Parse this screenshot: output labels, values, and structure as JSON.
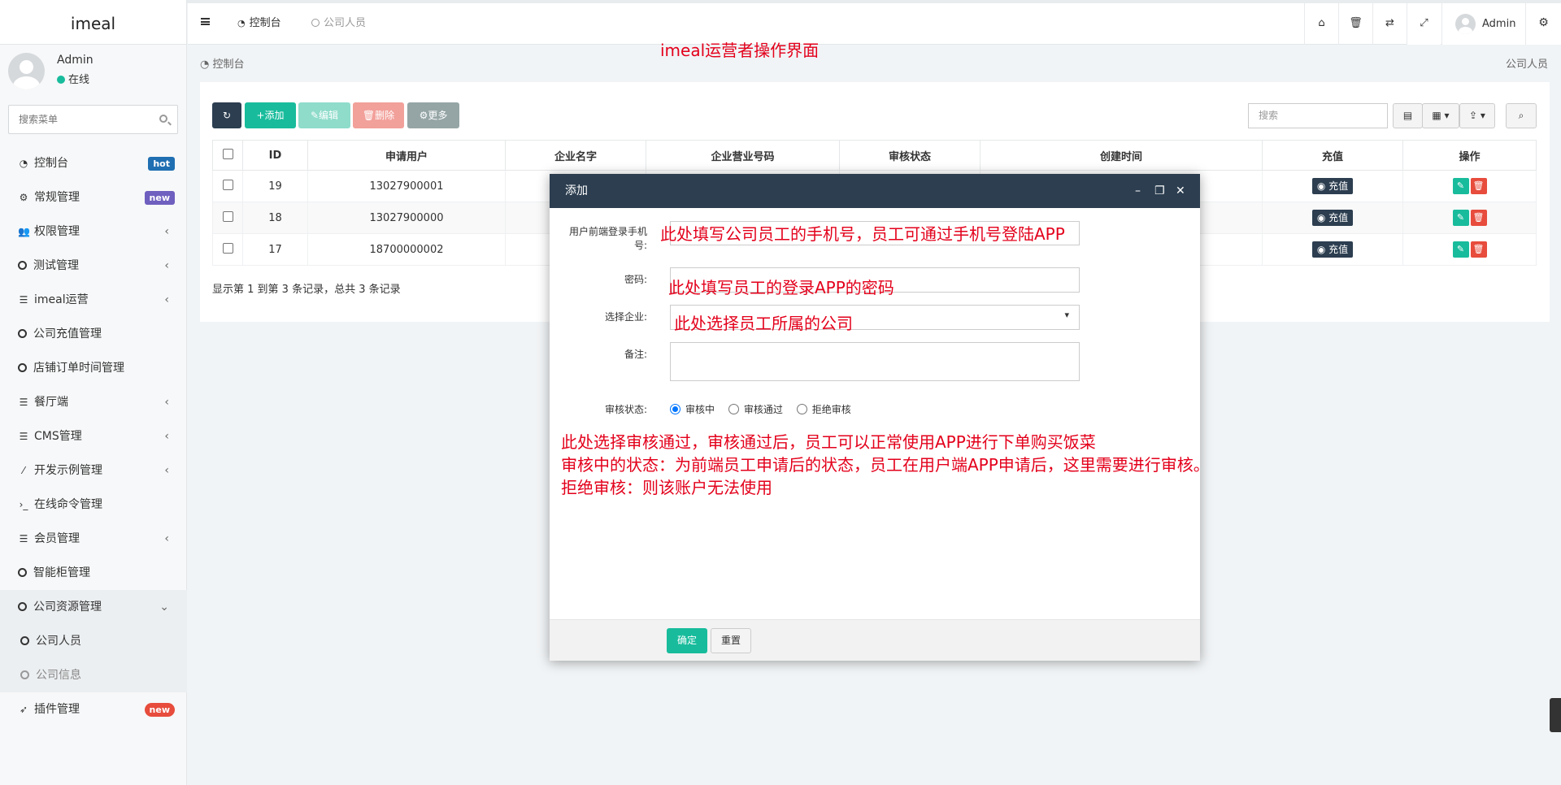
{
  "sidebar": {
    "logo": "imeal",
    "user": {
      "name": "Admin",
      "status": "在线"
    },
    "search_placeholder": "搜索菜单",
    "items": [
      {
        "label": "控制台",
        "icon": "dashboard-icon",
        "badge": "hot"
      },
      {
        "label": "常规管理",
        "icon": "cogs-icon",
        "badge": "new"
      },
      {
        "label": "权限管理",
        "icon": "group-icon"
      },
      {
        "label": "测试管理",
        "icon": "circle-icon"
      },
      {
        "label": "imeal运营",
        "icon": "list-icon"
      },
      {
        "label": "公司充值管理",
        "icon": "circle-icon"
      },
      {
        "label": "店铺订单时间管理",
        "icon": "circle-icon"
      },
      {
        "label": "餐厅端",
        "icon": "list-icon"
      },
      {
        "label": "CMS管理",
        "icon": "list-icon"
      },
      {
        "label": "开发示例管理",
        "icon": "magic-icon"
      },
      {
        "label": "在线命令管理",
        "icon": "terminal-icon"
      },
      {
        "label": "会员管理",
        "icon": "list-icon"
      },
      {
        "label": "智能柜管理",
        "icon": "circle-icon"
      },
      {
        "label": "公司资源管理",
        "icon": "circle-icon"
      },
      {
        "label": "公司人员",
        "icon": "circle-icon"
      },
      {
        "label": "公司信息",
        "icon": "circle-icon"
      },
      {
        "label": "插件管理",
        "icon": "rocket-icon",
        "badge": "new"
      }
    ]
  },
  "header": {
    "tabs": [
      {
        "label": "控制台",
        "icon": "dashboard-icon"
      },
      {
        "label": "公司人员",
        "icon": "circle-icon"
      }
    ],
    "user_name": "Admin",
    "buttons": [
      "home-icon",
      "trash-icon",
      "translate-icon",
      "fullscreen-icon",
      "cogs-icon"
    ]
  },
  "annotation_title": "imeal运营者操作界面",
  "breadcrumb": {
    "left": "控制台",
    "right": "公司人员"
  },
  "toolbar": {
    "add": "添加",
    "edit": "编辑",
    "delete": "删除",
    "more": "更多",
    "search_placeholder": "搜索"
  },
  "table": {
    "columns": [
      "ID",
      "申请用户",
      "企业名字",
      "企业营业号码",
      "审核状态",
      "创建时间",
      "充值",
      "操作"
    ],
    "rows": [
      {
        "id": "19",
        "user": "13027900001"
      },
      {
        "id": "18",
        "user": "13027900000"
      },
      {
        "id": "17",
        "user": "18700000002"
      }
    ],
    "recharge_label": "充值",
    "summary": "显示第 1 到第 3 条记录，总共 3 条记录"
  },
  "modal": {
    "title": "添加",
    "fields": {
      "phone_label": "用户前端登录手机号:",
      "password_label": "密码:",
      "company_label": "选择企业:",
      "remark_label": "备注:",
      "status_label": "审核状态:"
    },
    "radios": [
      "审核中",
      "审核通过",
      "拒绝审核"
    ],
    "ok": "确定",
    "reset": "重置",
    "annotations": {
      "phone": "此处填写公司员工的手机号，员工可通过手机号登陆APP",
      "password": "此处填写员工的登录APP的密码",
      "company": "此处选择员工所属的公司",
      "note1": "此处选择审核通过，审核通过后，员工可以正常使用APP进行下单购买饭菜",
      "note2": "审核中的状态：为前端员工申请后的状态，员工在用户端APP申请后，这里需要进行审核。",
      "note3": "拒绝审核：则该账户无法使用"
    }
  },
  "colors": {
    "dark": "#2c3e50",
    "success": "#18bc9c",
    "danger": "#e74c3c",
    "annotation": "#e3001b"
  }
}
